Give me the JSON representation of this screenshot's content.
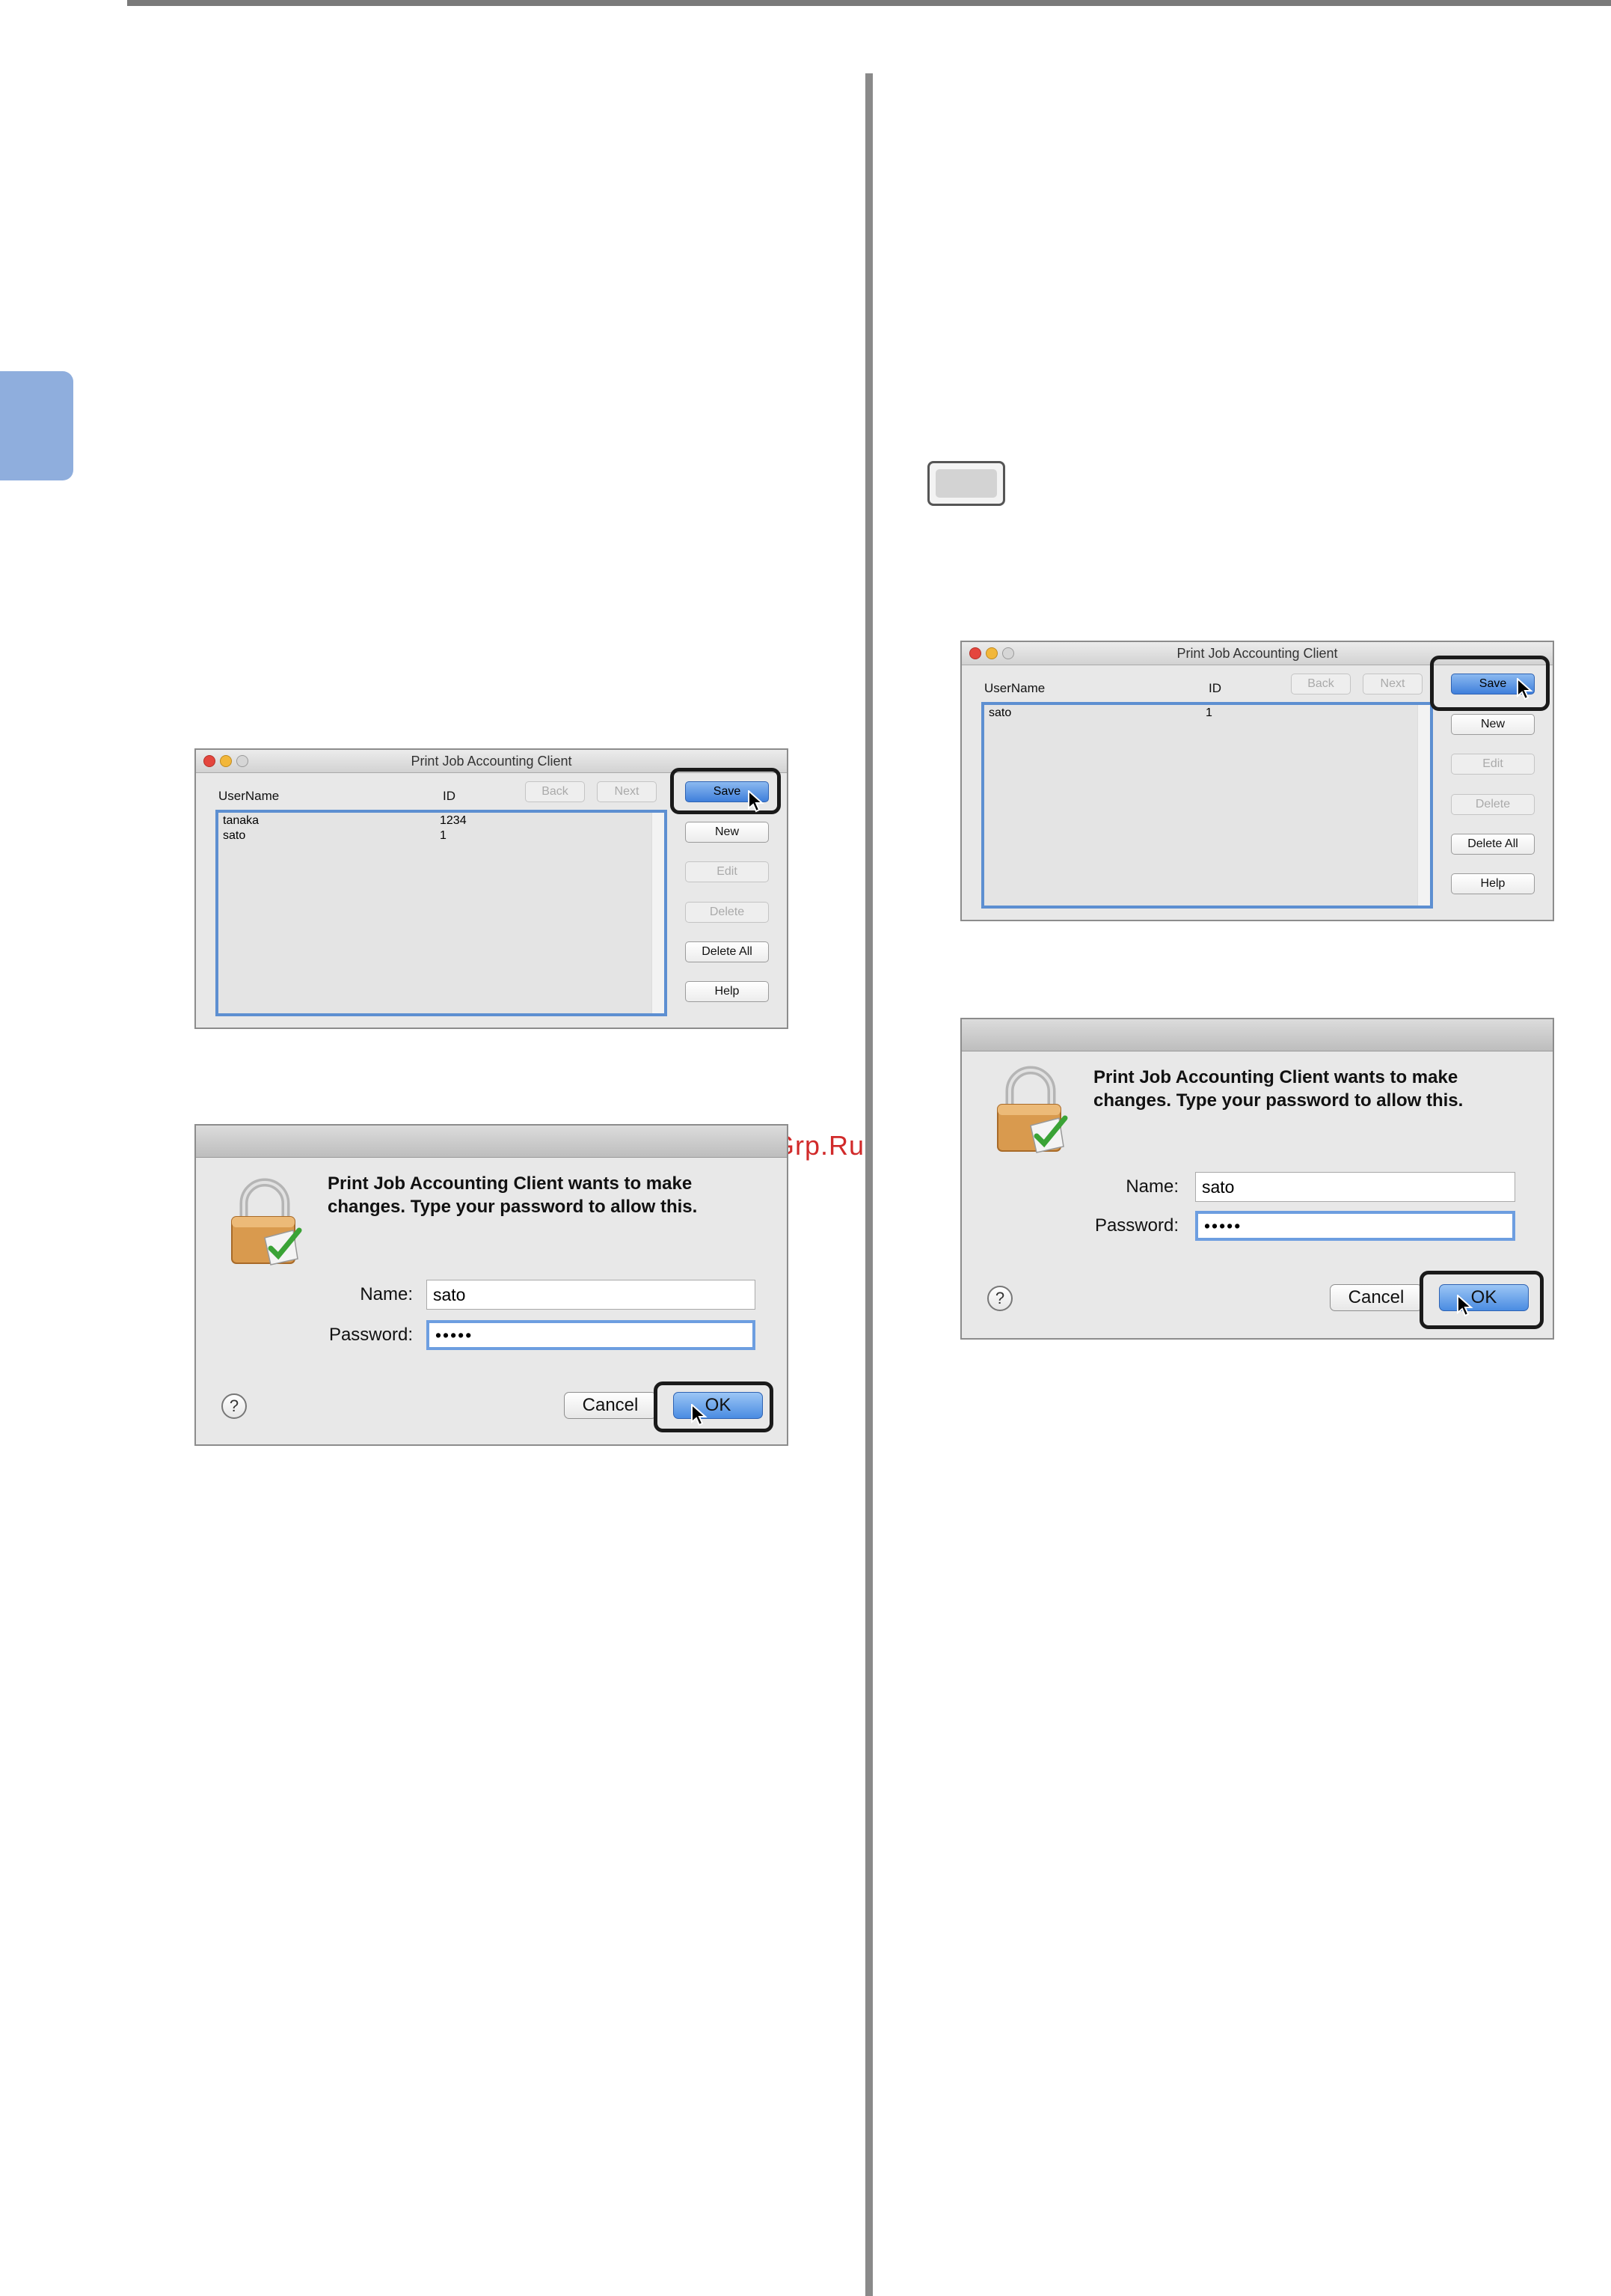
{
  "watermark": "McGrp.Ru",
  "app_window": {
    "title": "Print Job Accounting Client",
    "columns": {
      "username": "UserName",
      "id": "ID"
    },
    "nav": {
      "back": "Back",
      "next": "Next"
    },
    "buttons": {
      "save": "Save",
      "new": "New",
      "edit": "Edit",
      "delete": "Delete",
      "delete_all": "Delete All",
      "help": "Help"
    }
  },
  "left_list": [
    {
      "username": "tanaka",
      "id": "1234"
    },
    {
      "username": "sato",
      "id": "1"
    }
  ],
  "right_list": [
    {
      "username": "sato",
      "id": "1"
    }
  ],
  "auth_dialog": {
    "message_line1": "Print Job Accounting Client wants to make",
    "message_line2": "changes. Type your password to allow this.",
    "name_label": "Name:",
    "name_value": "sato",
    "password_label": "Password:",
    "password_value": "•••••",
    "help": "?",
    "cancel": "Cancel",
    "ok": "OK"
  }
}
